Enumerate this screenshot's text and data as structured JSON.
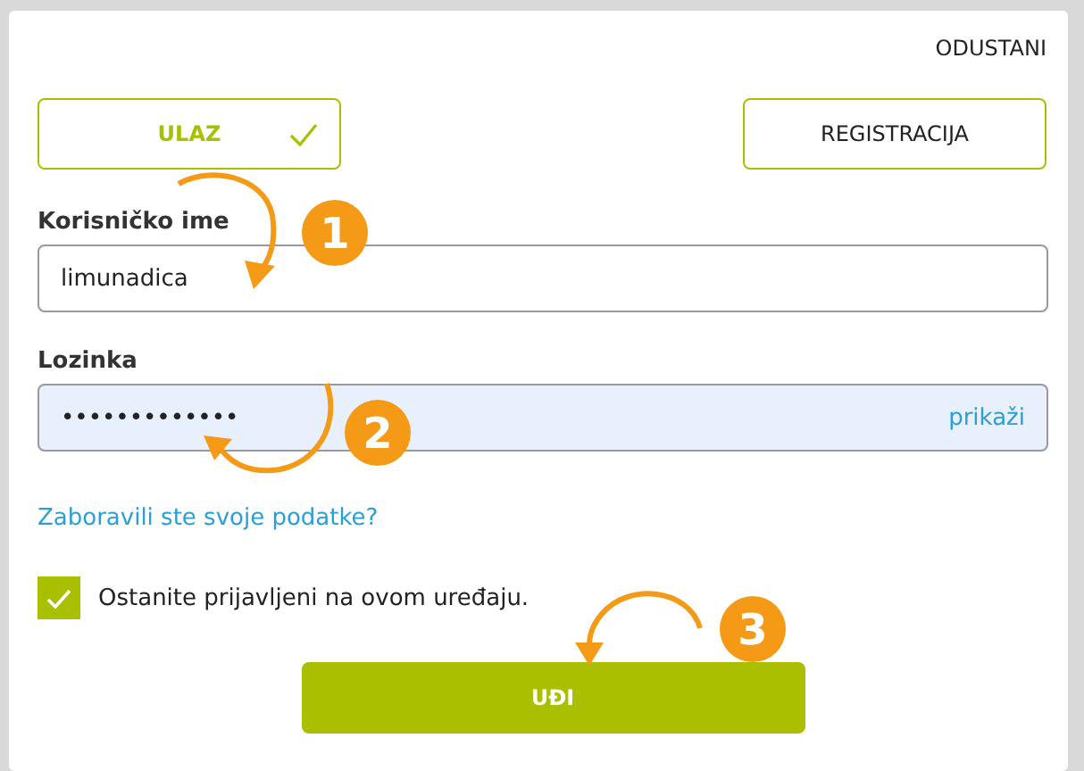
{
  "dialog": {
    "cancel": "ODUSTANI"
  },
  "tabs": [
    {
      "label": "ULAZ",
      "selected": true
    },
    {
      "label": "REGISTRACIJA",
      "selected": false
    }
  ],
  "fields": [
    {
      "kind": "text",
      "label": "Korisničko ime",
      "value": "limunadica"
    },
    {
      "kind": "password",
      "label": "Lozinka",
      "value": "•••••••••••••",
      "toggle": "prikaži"
    }
  ],
  "forgot_link": "Zaboravili ste svoje podatke?",
  "remember": {
    "label": "Ostanite prijavljeni na ovom uređaju.",
    "checked": true
  },
  "submit": "UĐI",
  "annotations": [
    "1",
    "2",
    "3"
  ]
}
